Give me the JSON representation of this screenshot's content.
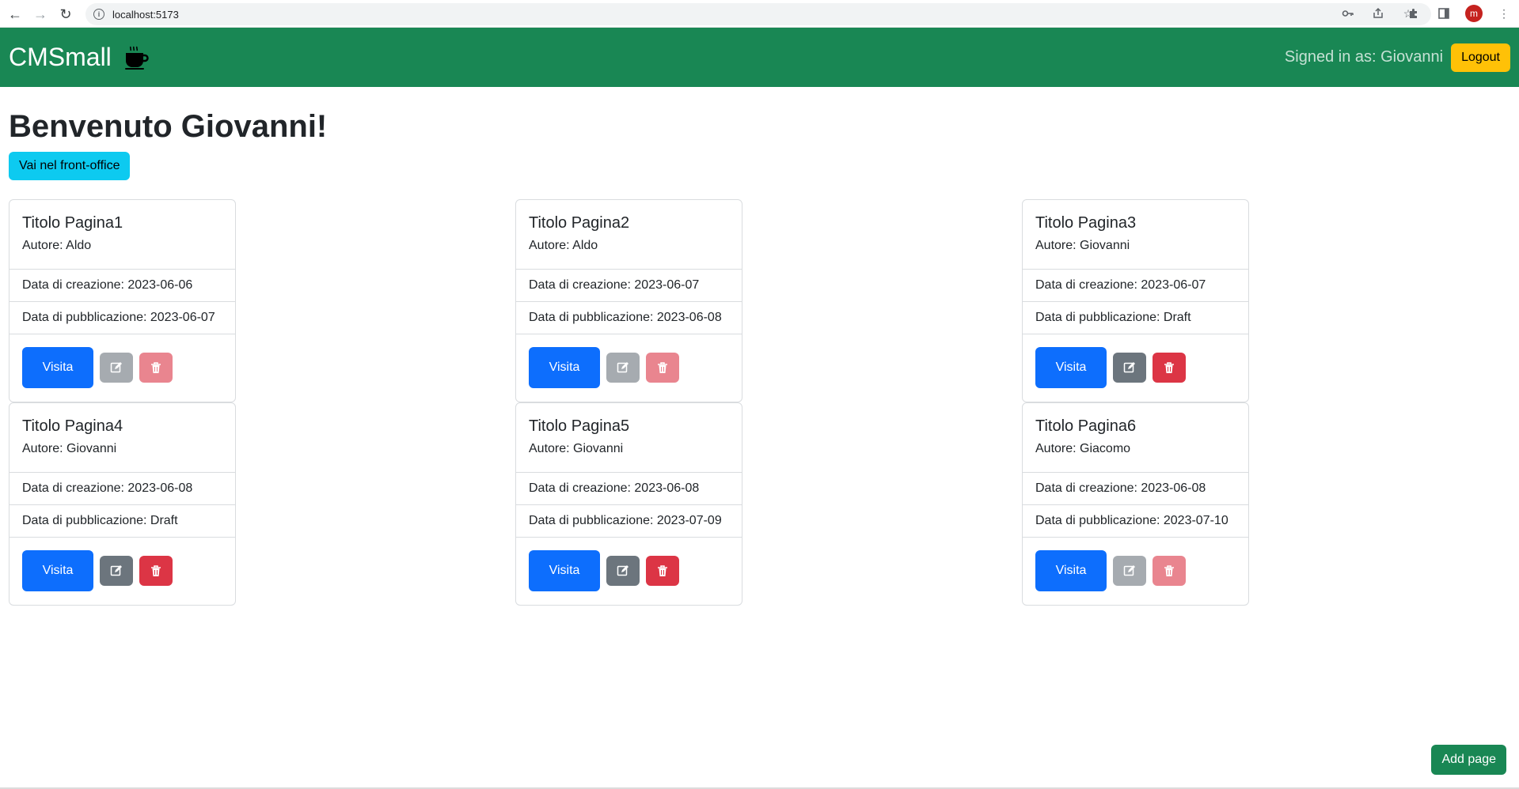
{
  "browser": {
    "url": "localhost:5173",
    "profile_initial": "m"
  },
  "navbar": {
    "brand": "CMSmall",
    "brand_icon": "coffee-cup-icon",
    "signed_in_text": "Signed in as: Giovanni",
    "logout_label": "Logout"
  },
  "main": {
    "welcome": "Benvenuto Giovanni!",
    "front_office_label": "Vai nel front-office",
    "add_page_label": "Add page"
  },
  "colors": {
    "navbar": "#198754",
    "logout": "#ffc107",
    "front_office": "#0dcaf0",
    "visit": "#0d6efd",
    "edit": "#6c757d",
    "delete": "#dc3545",
    "add_page": "#198754"
  },
  "cards": [
    {
      "title": "Titolo Pagina1",
      "author": "Autore: Aldo",
      "created": "Data di creazione: 2023-06-06",
      "published": "Data di pubblicazione: 2023-06-07",
      "visit_label": "Visita",
      "actions_enabled": false
    },
    {
      "title": "Titolo Pagina2",
      "author": "Autore: Aldo",
      "created": "Data di creazione: 2023-06-07",
      "published": "Data di pubblicazione: 2023-06-08",
      "visit_label": "Visita",
      "actions_enabled": false
    },
    {
      "title": "Titolo Pagina3",
      "author": "Autore: Giovanni",
      "created": "Data di creazione: 2023-06-07",
      "published": "Data di pubblicazione: Draft",
      "visit_label": "Visita",
      "actions_enabled": true
    },
    {
      "title": "Titolo Pagina4",
      "author": "Autore: Giovanni",
      "created": "Data di creazione: 2023-06-08",
      "published": "Data di pubblicazione: Draft",
      "visit_label": "Visita",
      "actions_enabled": true
    },
    {
      "title": "Titolo Pagina5",
      "author": "Autore: Giovanni",
      "created": "Data di creazione: 2023-06-08",
      "published": "Data di pubblicazione: 2023-07-09",
      "visit_label": "Visita",
      "actions_enabled": true
    },
    {
      "title": "Titolo Pagina6",
      "author": "Autore: Giacomo",
      "created": "Data di creazione: 2023-06-08",
      "published": "Data di pubblicazione: 2023-07-10",
      "visit_label": "Visita",
      "actions_enabled": false
    }
  ]
}
